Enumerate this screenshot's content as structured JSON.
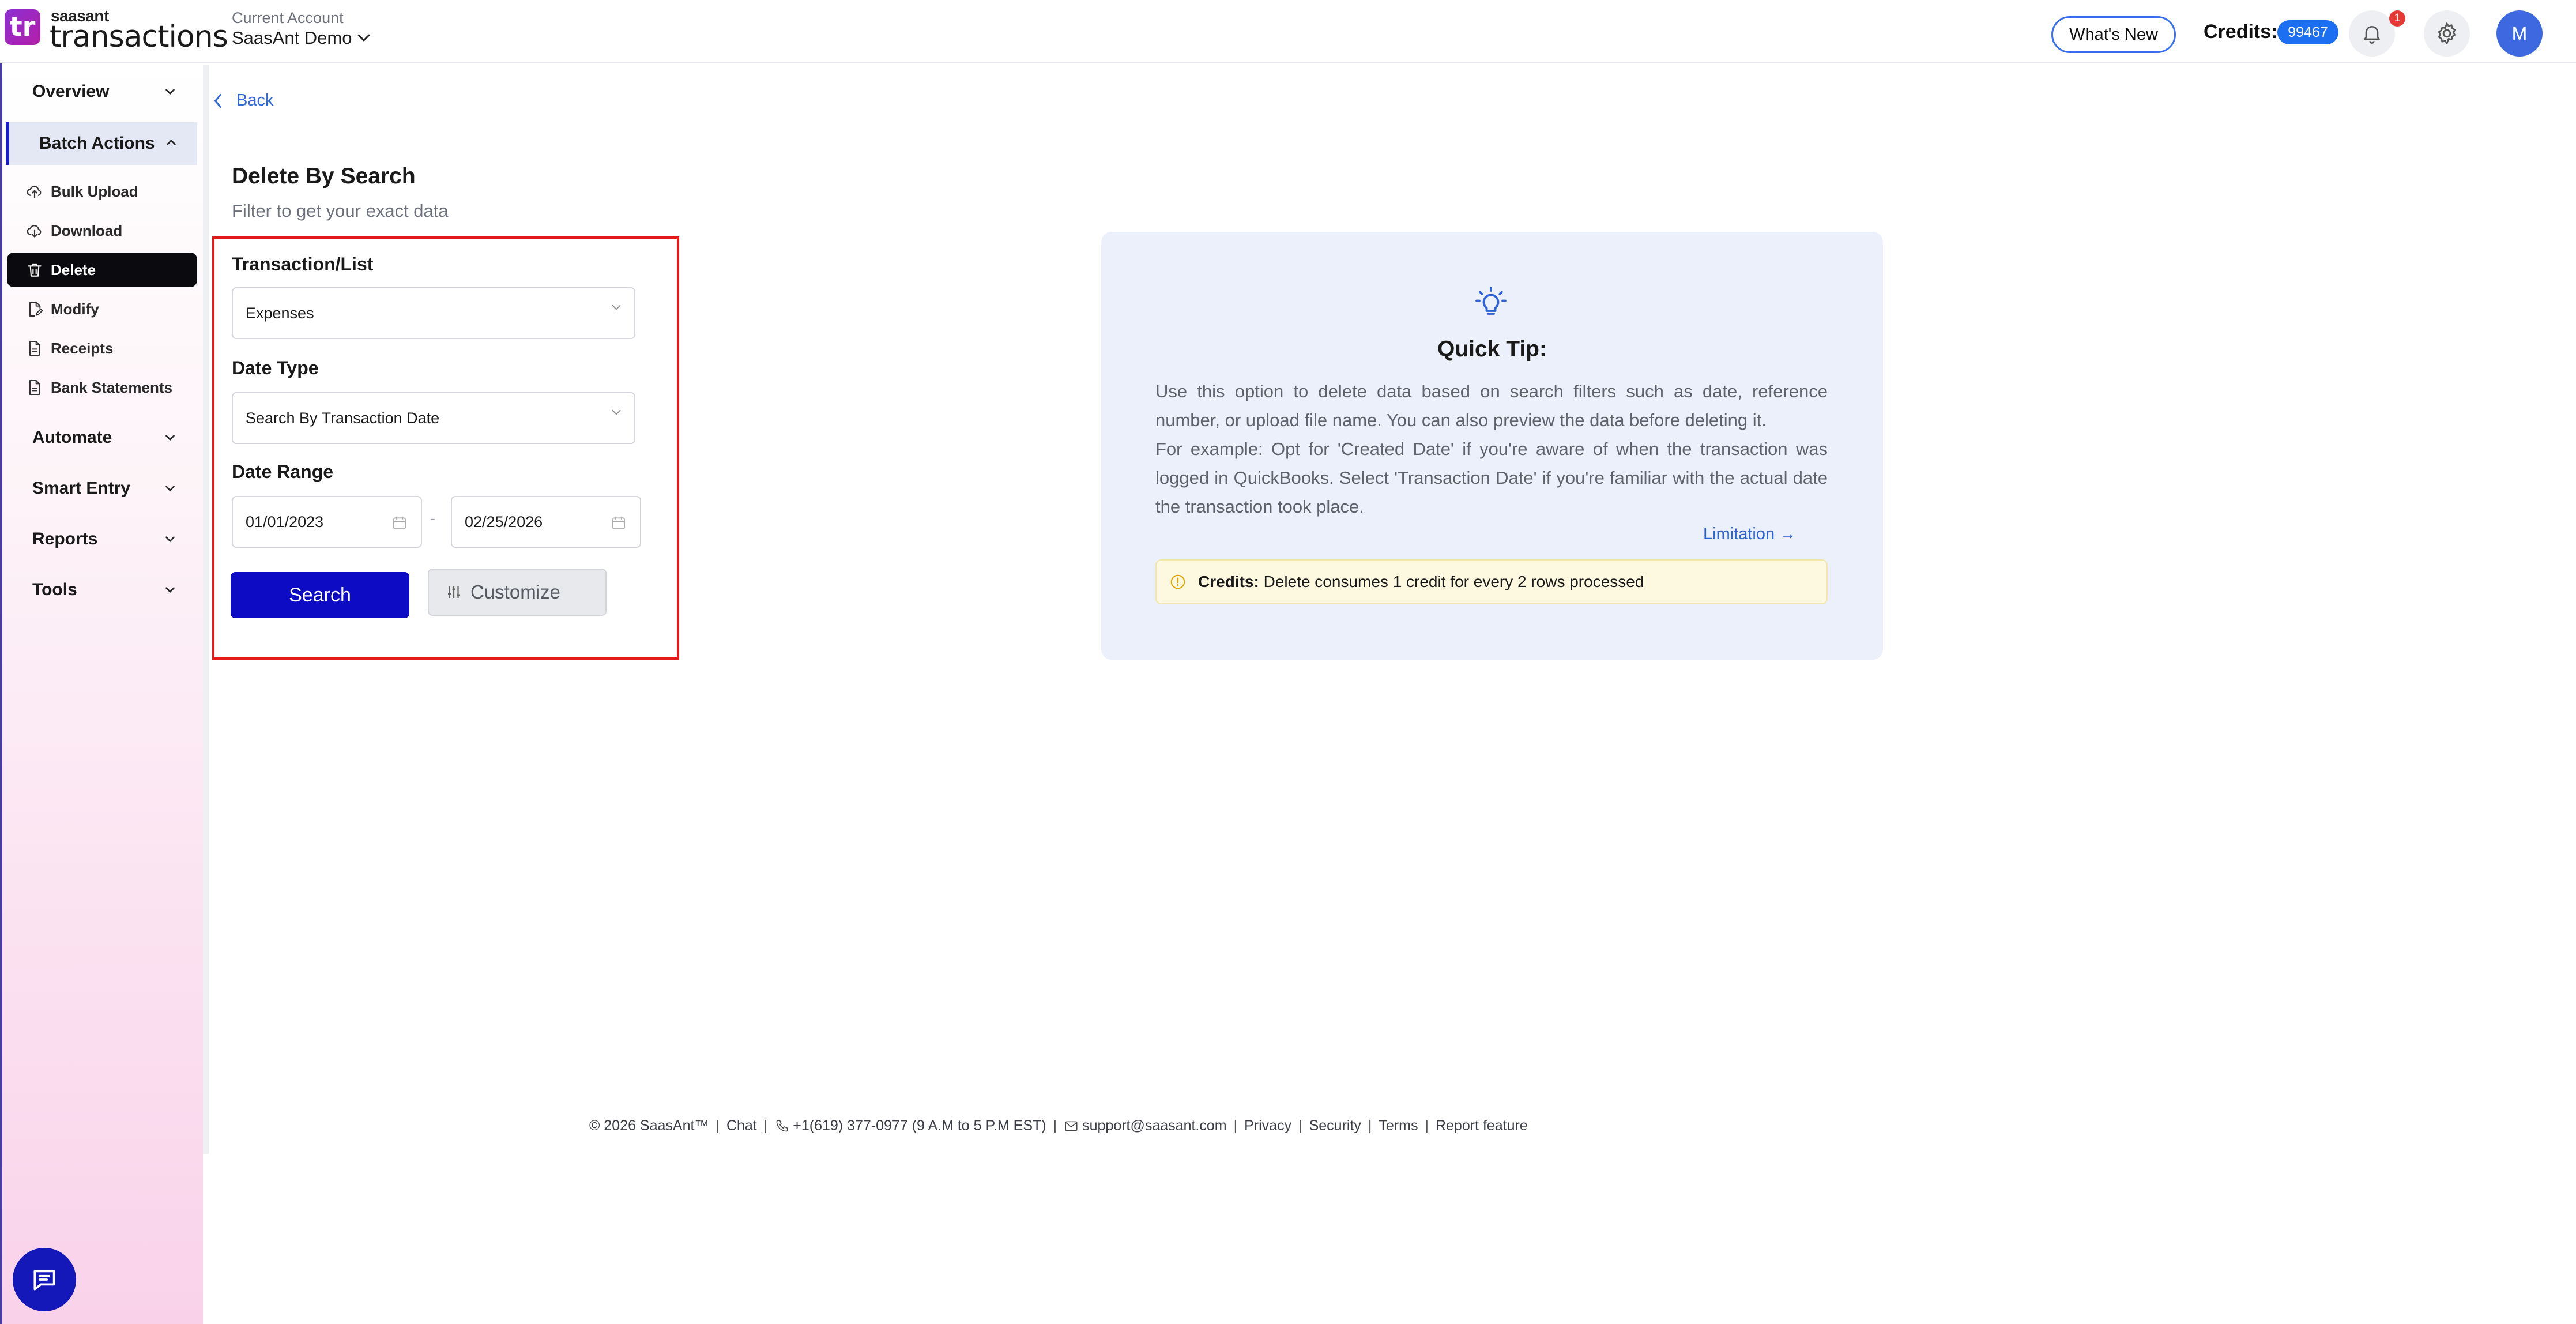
{
  "header": {
    "logo_mark": "tr",
    "brand": "saasant",
    "product": "transactions",
    "account_caption": "Current Account",
    "account_name": "SaasAnt Demo",
    "whats_new": "What's New",
    "credits_label": "Credits:",
    "credits_value": "99467",
    "notification_count": "1",
    "avatar_initial": "M"
  },
  "sidebar": {
    "groups": [
      {
        "label": "Overview"
      },
      {
        "label": "Batch Actions"
      },
      {
        "label": "Automate"
      },
      {
        "label": "Smart Entry"
      },
      {
        "label": "Reports"
      },
      {
        "label": "Tools"
      }
    ],
    "batch_items": [
      {
        "label": "Bulk Upload",
        "icon": "cloud-upload-icon"
      },
      {
        "label": "Download",
        "icon": "cloud-download-icon"
      },
      {
        "label": "Delete",
        "icon": "trash-icon"
      },
      {
        "label": "Modify",
        "icon": "edit-document-icon"
      },
      {
        "label": "Receipts",
        "icon": "document-icon"
      },
      {
        "label": "Bank Statements",
        "icon": "document-icon"
      }
    ]
  },
  "main": {
    "back_label": "Back",
    "title": "Delete By Search",
    "subtitle": "Filter to get your exact data",
    "transaction_label": "Transaction/List",
    "transaction_value": "Expenses",
    "date_type_label": "Date Type",
    "date_type_value": "Search By Transaction Date",
    "date_range_label": "Date Range",
    "date_from": "01/01/2023",
    "date_separator": "-",
    "date_to": "02/25/2026",
    "search_button": "Search",
    "customize_button": "Customize"
  },
  "tip": {
    "title": "Quick Tip:",
    "paragraph1": "Use this option to delete data based on search filters such as date, reference number, or upload file name. You can also preview the data before deleting it.",
    "paragraph2": "For example: Opt for 'Created Date' if you're aware of when the transaction was logged in QuickBooks. Select 'Transaction Date' if you're familiar with the actual date the transaction took place.",
    "limitation_link": "Limitation →",
    "credits_label": "Credits:",
    "credits_text": "Delete consumes 1 credit for every 2 rows processed"
  },
  "footer": {
    "copyright": "© 2026 SaasAnt™",
    "chat": "Chat",
    "phone": "+1(619) 377-0977 (9 A.M to 5 P.M EST)",
    "email": "support@saasant.com",
    "privacy": "Privacy",
    "security": "Security",
    "terms": "Terms",
    "report": "Report feature"
  },
  "colors": {
    "primary": "#0d0bc4",
    "accent_blue": "#1d6ff2",
    "highlight_border": "#e31b1b",
    "tip_background": "#ebf0fa"
  }
}
